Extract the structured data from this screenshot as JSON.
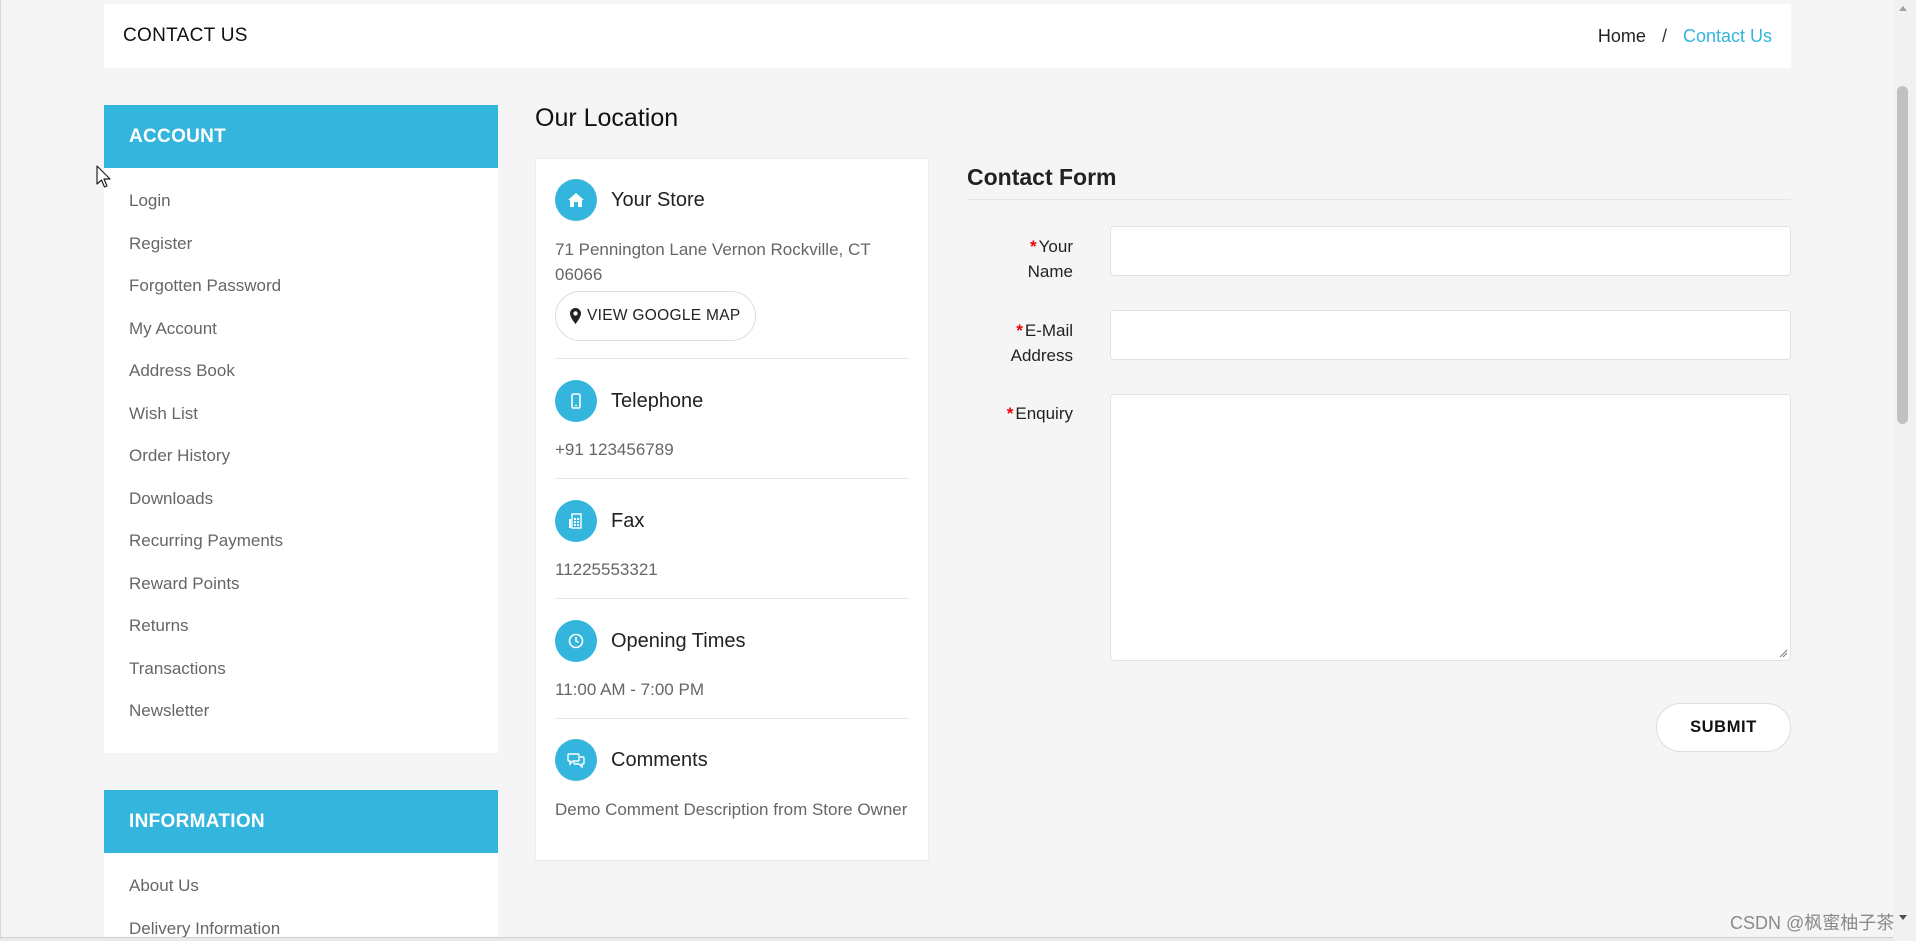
{
  "header": {
    "page_title": "CONTACT US",
    "breadcrumb": {
      "home": "Home",
      "separator": "/",
      "current": "Contact Us"
    }
  },
  "sidebar": {
    "account": {
      "title": "ACCOUNT",
      "items": [
        "Login",
        "Register",
        "Forgotten Password",
        "My Account",
        "Address Book",
        "Wish List",
        "Order History",
        "Downloads",
        "Recurring Payments",
        "Reward Points",
        "Returns",
        "Transactions",
        "Newsletter"
      ]
    },
    "information": {
      "title": "INFORMATION",
      "items": [
        "About Us",
        "Delivery Information"
      ]
    }
  },
  "location": {
    "title": "Our Location",
    "store": {
      "label": "Your Store",
      "address": "71 Pennington Lane Vernon Rockville, CT 06066",
      "map_button": "VIEW GOOGLE MAP",
      "icon": "home-icon"
    },
    "telephone": {
      "label": "Telephone",
      "value": "+91 123456789",
      "icon": "mobile-icon"
    },
    "fax": {
      "label": "Fax",
      "value": "11225553321",
      "icon": "fax-icon"
    },
    "opening": {
      "label": "Opening Times",
      "value": "11:00 AM - 7:00 PM",
      "icon": "clock-icon"
    },
    "comments": {
      "label": "Comments",
      "value": "Demo Comment Description from Store Owner",
      "icon": "comments-icon"
    }
  },
  "form": {
    "title": "Contact Form",
    "required_marker": "*",
    "name_label_1": "Your",
    "name_label_2": "Name",
    "email_label_1": "E-Mail",
    "email_label_2": "Address",
    "enquiry_label": "Enquiry",
    "name_value": "",
    "email_value": "",
    "enquiry_value": "",
    "submit": "SUBMIT"
  },
  "watermark": "CSDN @枫蜜柚子茶",
  "colors": {
    "accent": "#33b5de",
    "required": "#ee0000"
  }
}
